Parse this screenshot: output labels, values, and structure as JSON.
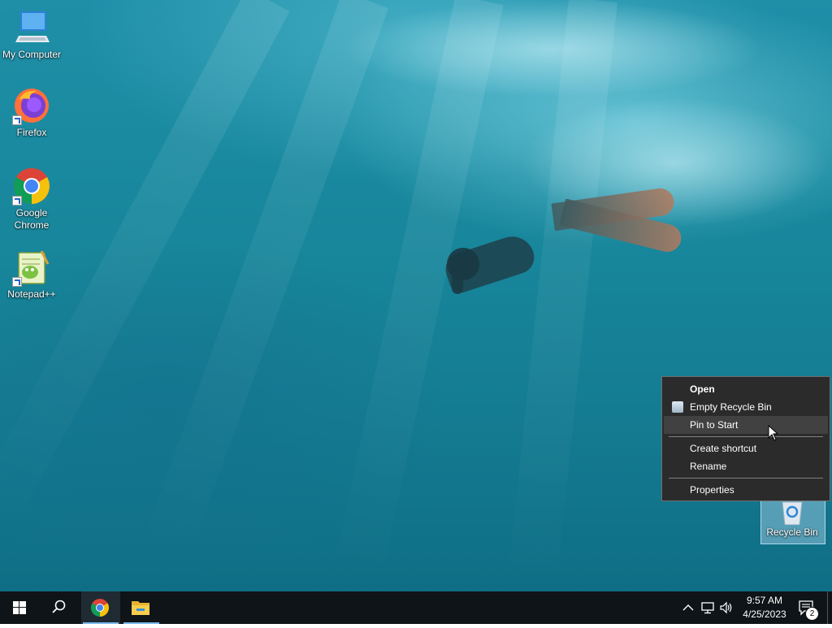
{
  "desktop_icons": [
    {
      "label": "My Computer",
      "icon": "computer-icon"
    },
    {
      "label": "Firefox",
      "icon": "firefox-icon"
    },
    {
      "label": "Google Chrome",
      "icon": "chrome-icon"
    },
    {
      "label": "Notepad++",
      "icon": "notepad-plus-plus-icon"
    },
    {
      "label": "Recycle Bin",
      "icon": "recycle-bin-icon"
    }
  ],
  "context_menu": {
    "items": [
      {
        "label": "Open",
        "bold": true
      },
      {
        "label": "Empty Recycle Bin",
        "icon": "recycle-bin-small-icon"
      },
      {
        "label": "Pin to Start",
        "hovered": true
      },
      {
        "label": "Create shortcut"
      },
      {
        "label": "Rename"
      },
      {
        "label": "Properties"
      }
    ]
  },
  "taskbar": {
    "start": "windows-logo-icon",
    "search": "search-icon",
    "pinned": [
      "chrome-icon",
      "file-explorer-icon"
    ],
    "tray": [
      "chevron-up-icon",
      "network-icon",
      "volume-icon"
    ],
    "clock": {
      "time": "9:57 AM",
      "date": "4/25/2023"
    },
    "notifications": {
      "count": "2"
    }
  }
}
